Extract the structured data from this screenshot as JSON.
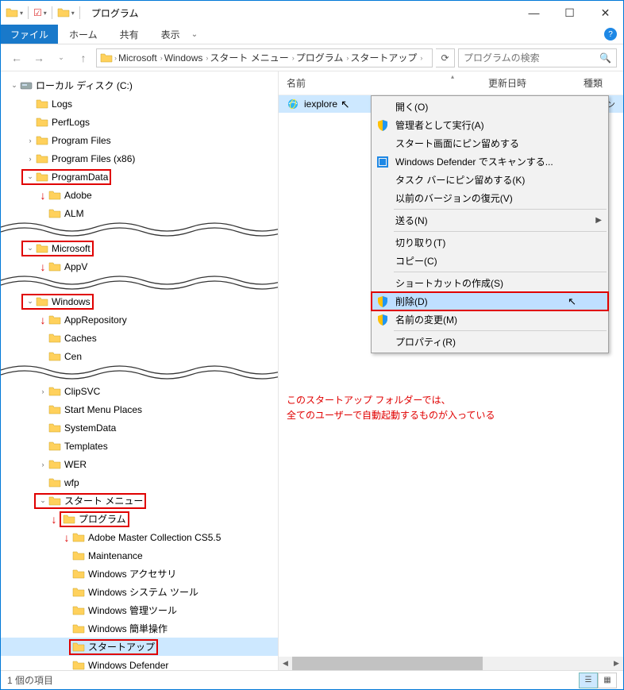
{
  "window": {
    "title": "プログラム",
    "min": "—",
    "max": "☐",
    "close": "✕"
  },
  "ribbon": {
    "file": "ファイル",
    "tabs": [
      "ホーム",
      "共有",
      "表示"
    ],
    "expand": "⌄"
  },
  "nav": {
    "back": "←",
    "fwd": "→",
    "drop": "⌄",
    "up": "↑",
    "refresh": "⟳"
  },
  "breadcrumbs": [
    "Microsoft",
    "Windows",
    "スタート メニュー",
    "プログラム",
    "スタートアップ"
  ],
  "search": {
    "placeholder": "プログラムの検索"
  },
  "columns": {
    "name": "名前",
    "date": "更新日時",
    "type": "種類"
  },
  "file": {
    "name": "iexplore",
    "badge": "ーション"
  },
  "tree": {
    "root": "ローカル ディスク (C:)",
    "l1": [
      "Logs",
      "PerfLogs",
      "Program Files",
      "Program Files (x86)"
    ],
    "programdata": "ProgramData",
    "pd_children": [
      "Adobe",
      "ALM"
    ],
    "microsoft": "Microsoft",
    "ms_children": [
      "AppV"
    ],
    "windows": "Windows",
    "win_children": [
      "AppRepository",
      "Caches",
      "Cen",
      "ClipSVC",
      "Start Menu Places",
      "SystemData",
      "Templates",
      "WER",
      "wfp"
    ],
    "startmenu": "スタート メニュー",
    "programs": "プログラム",
    "prog_children": [
      "Adobe Master Collection CS5.5",
      "Maintenance",
      "Windows アクセサリ",
      "Windows システム ツール",
      "Windows 管理ツール",
      "Windows 簡単操作"
    ],
    "startup": "スタートアップ",
    "last": "Windows Defender"
  },
  "context": {
    "open": "開く(O)",
    "admin": "管理者として実行(A)",
    "pin_start": "スタート画面にピン留めする",
    "defender": "Windows Defender でスキャンする...",
    "pin_task": "タスク バーにピン留めする(K)",
    "prev_ver": "以前のバージョンの復元(V)",
    "send": "送る(N)",
    "cut": "切り取り(T)",
    "copy": "コピー(C)",
    "shortcut": "ショートカットの作成(S)",
    "delete": "削除(D)",
    "rename": "名前の変更(M)",
    "props": "プロパティ(R)"
  },
  "annotation": {
    "line1": "このスタートアップ フォルダーでは、",
    "line2": "全てのユーザーで自動起動するものが入っている"
  },
  "status": {
    "text": "1 個の項目"
  }
}
